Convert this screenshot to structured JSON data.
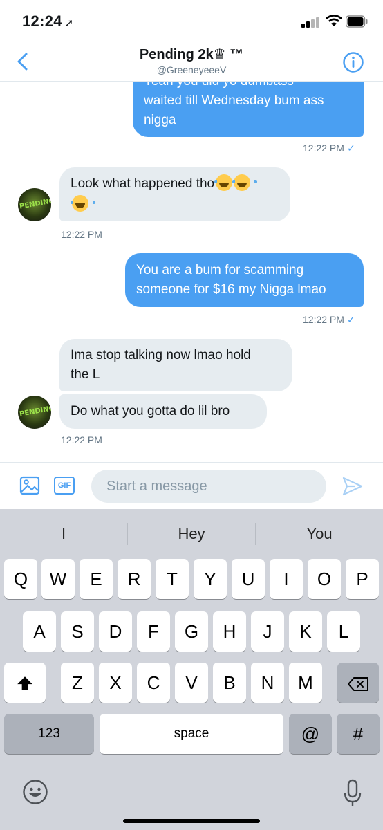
{
  "status_bar": {
    "time": "12:24",
    "location_arrow": "location-arrow-icon"
  },
  "header": {
    "title": "Pending 2k♛ ™",
    "handle": "@GreeneyeeeV"
  },
  "messages": [
    {
      "side": "sent",
      "text_lines": [
        "Yeah you did yo dumbass",
        "waited till Wednesday bum ass",
        "nigga"
      ]
    },
    {
      "side": "timestamp-sent",
      "text": "12:22 PM",
      "check": "✓"
    },
    {
      "side": "received",
      "text_lines": [
        "Look what happened tho",
        ""
      ],
      "emojis": [
        "face-with-tears-of-joy",
        "face-with-tears-of-joy",
        "face-with-tears-of-joy"
      ]
    },
    {
      "side": "timestamp-received",
      "text": "12:22 PM"
    },
    {
      "side": "sent",
      "text_lines": [
        "You are a bum for scamming",
        "someone for $16 my Nigga lmao"
      ]
    },
    {
      "side": "timestamp-sent",
      "text": "12:22 PM",
      "check": "✓"
    },
    {
      "side": "received",
      "text_lines": [
        "Ima stop talking now lmao hold",
        "the L"
      ]
    },
    {
      "side": "received",
      "text_lines": [
        "Do what you gotta do lil bro"
      ]
    },
    {
      "side": "timestamp-received",
      "text": "12:22 PM"
    }
  ],
  "avatar_text": "PENDING",
  "composer": {
    "placeholder": "Start a message",
    "gif_label": "GIF"
  },
  "keyboard": {
    "suggestions": [
      "I",
      "Hey",
      "You"
    ],
    "row1": [
      "Q",
      "W",
      "E",
      "R",
      "T",
      "Y",
      "U",
      "I",
      "O",
      "P"
    ],
    "row2": [
      "A",
      "S",
      "D",
      "F",
      "G",
      "H",
      "J",
      "K",
      "L"
    ],
    "row3": [
      "Z",
      "X",
      "C",
      "V",
      "B",
      "N",
      "M"
    ],
    "numbers_label": "123",
    "space_label": "space",
    "at_label": "@",
    "hash_label": "#"
  },
  "colors": {
    "accent": "#4a9ff2",
    "received_bubble": "#e6ecf0",
    "keyboard_bg": "#d1d4db"
  }
}
